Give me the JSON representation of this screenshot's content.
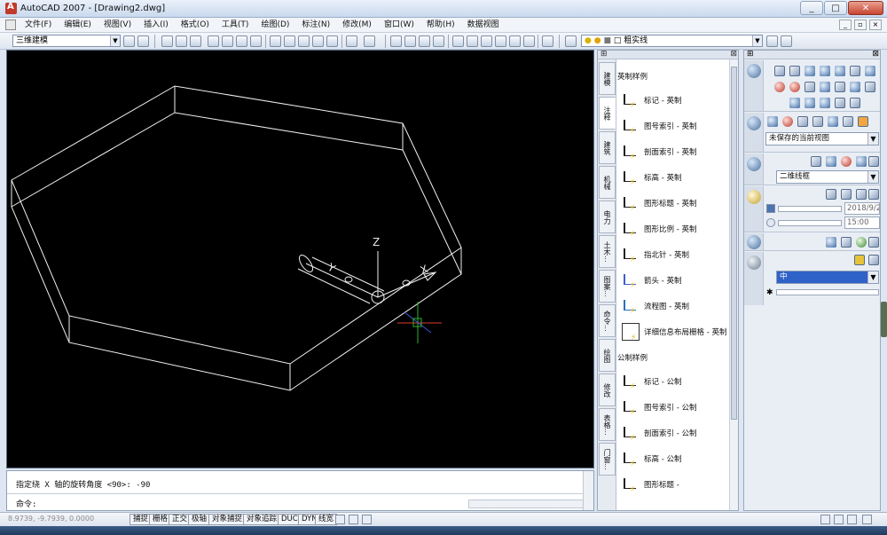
{
  "window": {
    "title": "AutoCAD 2007 - [Drawing2.dwg]",
    "controls": [
      "_",
      "□",
      "✕"
    ],
    "mdi_controls": [
      "_",
      "▫",
      "×"
    ]
  },
  "menu": [
    "文件(F)",
    "编辑(E)",
    "视图(V)",
    "插入(I)",
    "格式(O)",
    "工具(T)",
    "绘图(D)",
    "标注(N)",
    "修改(M)",
    "窗口(W)",
    "帮助(H)",
    "数据视图"
  ],
  "toolbar": {
    "workspace": "三维建模",
    "layer": "粗实线"
  },
  "viewport": {
    "axis_z": "Z",
    "axis_y": "Y",
    "axis_x": "X"
  },
  "command": {
    "history": "指定绕 X 轴的旋转角度 <90>: -90",
    "prompt": "命令:"
  },
  "status": {
    "coords": "8.9739, -9.7939, 0.0000",
    "buttons": [
      "捕捉",
      "栅格",
      "正交",
      "极轴",
      "对象捕捉",
      "对象追踪",
      "DUCS",
      "DYN",
      "线宽"
    ]
  },
  "palette": {
    "tabs": [
      "建模",
      "注释",
      "建筑",
      "机械",
      "电力",
      "土木...",
      "图案...",
      "命令...",
      "绘图",
      "修改",
      "表格...",
      "门窗..."
    ],
    "sections": [
      {
        "title": "英制样例",
        "items": [
          "标记 - 英制",
          "图号索引 - 英制",
          "剖面索引 - 英制",
          "标高 - 英制",
          "图形标题 - 英制",
          "图形比例 - 英制",
          "指北针 - 英制",
          "箭头 - 英制",
          "流程图 - 英制",
          "详细信息布局栅格 - 英制"
        ]
      },
      {
        "title": "公制样例",
        "items": [
          "标记 - 公制",
          "图号索引 - 公制",
          "剖面索引 - 公制",
          "标高 - 公制",
          "图形标题 -"
        ]
      }
    ]
  },
  "dashboard": {
    "view_combo": "未保存的当前视图",
    "visual_style": "二维线框",
    "date": "2018/9/2",
    "time": "15:00",
    "material": "中"
  }
}
